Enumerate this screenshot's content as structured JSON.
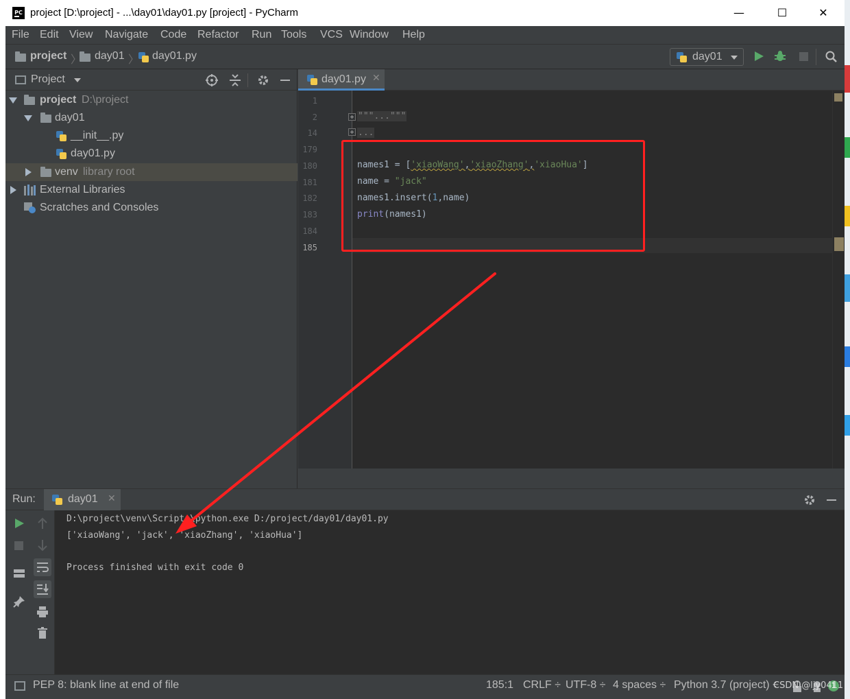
{
  "window": {
    "title": "project [D:\\project] - ...\\day01\\day01.py [project] - PyCharm",
    "app_icon_text": "PC",
    "minimize": "—",
    "maximize": "☐",
    "close": "✕"
  },
  "menu": [
    "File",
    "Edit",
    "View",
    "Navigate",
    "Code",
    "Refactor",
    "Run",
    "Tools",
    "VCS",
    "Window",
    "Help"
  ],
  "breadcrumb": [
    "project",
    "day01",
    "day01.py"
  ],
  "run_config": "day01",
  "project_panel": {
    "title": "Project",
    "tree": [
      {
        "label": "project",
        "path": "D:\\project"
      },
      {
        "label": "day01"
      },
      {
        "label": "__init__.py"
      },
      {
        "label": "day01.py"
      },
      {
        "label": "venv",
        "suffix": "library root"
      },
      {
        "label": "External Libraries"
      },
      {
        "label": "Scratches and Consoles"
      }
    ]
  },
  "editor": {
    "tab": "day01.py",
    "line_numbers": [
      "1",
      "2",
      "14",
      "179",
      "180",
      "181",
      "182",
      "183",
      "184",
      "185"
    ],
    "current_line": "185",
    "folded_docstring": "\"\"\"...\"\"\"",
    "folded_block": "...",
    "code": {
      "l180_var": "names1 = [",
      "l180_s1": "'xiaoWang'",
      "l180_c1": ",",
      "l180_s2": "'xiaoZhang'",
      "l180_c2": ",",
      "l180_s3": "'xiaoHua'",
      "l180_end": "]",
      "l181_var": "name = ",
      "l181_str": "\"jack\"",
      "l182_a": "names1.insert(",
      "l182_num": "1",
      "l182_b": ",name)",
      "l183_fn": "print",
      "l183_rest": "(names1)"
    }
  },
  "run_panel": {
    "label": "Run:",
    "tab": "day01",
    "console": [
      "D:\\project\\venv\\Scripts\\python.exe D:/project/day01/day01.py",
      "['xiaoWang', 'jack', 'xiaoZhang', 'xiaoHua']",
      "",
      "Process finished with exit code 0"
    ]
  },
  "status": {
    "message": "PEP 8: blank line at end of file",
    "position": "185:1",
    "line_sep": "CRLF ÷",
    "encoding": "UTF-8 ÷",
    "indent": "4 spaces ÷",
    "interpreter": "Python 3.7 (project) ÷"
  },
  "watermark": "CSDN @ljy0411",
  "colors": {
    "accent_run": "#59a869",
    "annotation": "#ff2020",
    "tab_underline": "#4a88c7"
  }
}
